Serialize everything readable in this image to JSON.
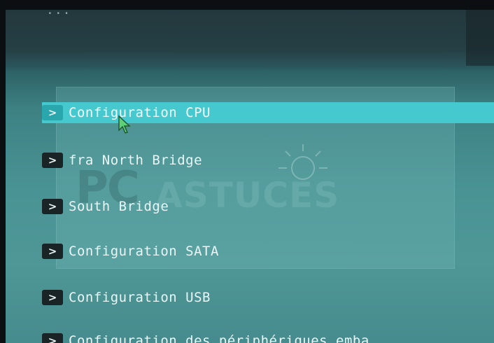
{
  "header": {
    "partial_text": "..."
  },
  "watermark": {
    "pc": "PC",
    "astuces": "ASTUCES"
  },
  "menu": {
    "items": [
      {
        "label": "Configuration CPU",
        "selected": true
      },
      {
        "label": "fra North Bridge",
        "selected": false
      },
      {
        "label": "South Bridge",
        "selected": false
      },
      {
        "label": "Configuration SATA",
        "selected": false
      },
      {
        "label": "Configuration USB",
        "selected": false
      },
      {
        "label": "Configuration des périphériques emba",
        "selected": false
      }
    ],
    "arrow_glyph": ">"
  },
  "colors": {
    "highlight": "#45c9cf",
    "background": "#4a9394",
    "header": "#253f44",
    "arrow_box": "#1a2326"
  },
  "icons": {
    "cursor": "mouse-pointer-icon",
    "menu_arrow": "chevron-right-icon",
    "watermark_bulb": "lightbulb-icon"
  }
}
